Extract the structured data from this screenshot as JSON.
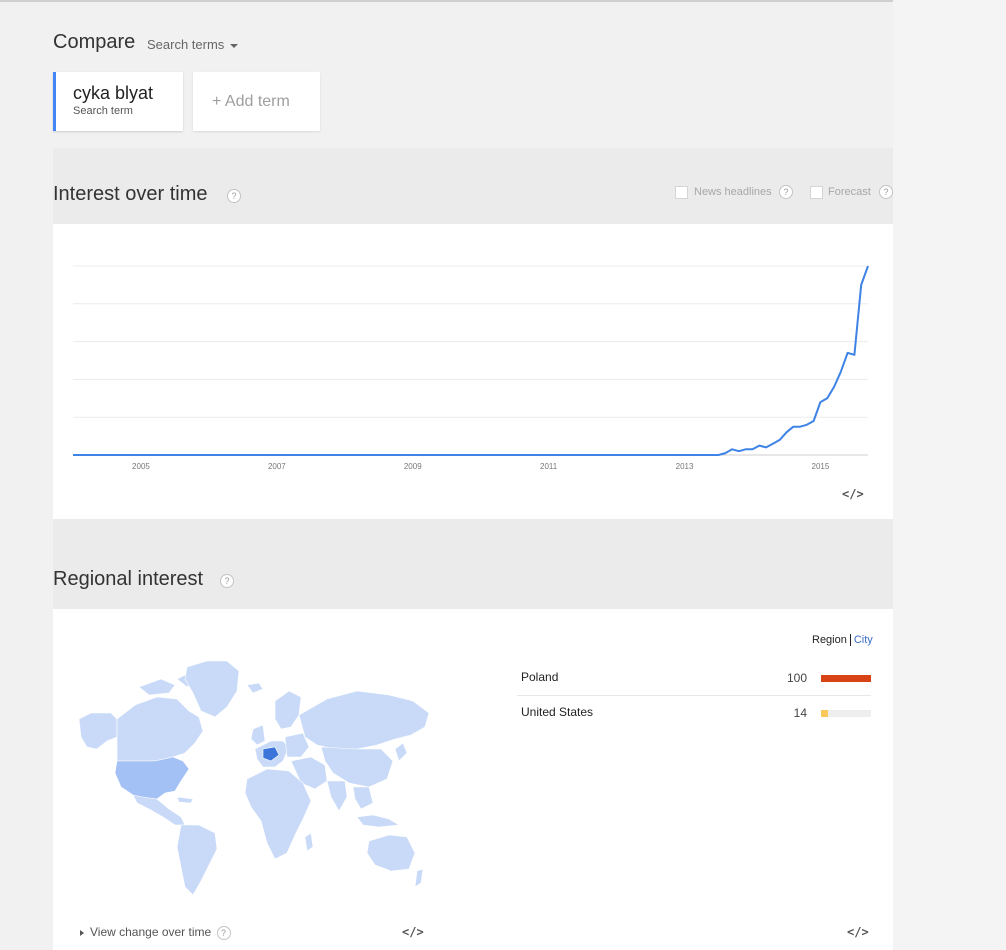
{
  "compare": {
    "title": "Compare",
    "dropdown_label": "Search terms"
  },
  "terms": [
    {
      "term": "cyka blyat",
      "type": "Search term",
      "color": "#4285f4"
    }
  ],
  "add_term": {
    "label": "+ Add term"
  },
  "interest_over_time": {
    "title": "Interest over time",
    "help": "?",
    "options": [
      {
        "label": "News headlines",
        "checked": false
      },
      {
        "label": "Forecast",
        "checked": false
      }
    ],
    "embed": "</>"
  },
  "chart_data": {
    "type": "line",
    "x_labels": [
      "2005",
      "2007",
      "2009",
      "2011",
      "2013",
      "2015"
    ],
    "xlim": [
      2004.0,
      2015.7
    ],
    "ylim": [
      0,
      100
    ],
    "grid": true,
    "line_color": "#3e83e5",
    "series": [
      {
        "x": [
          2004.0,
          2013.5,
          2013.6,
          2013.7,
          2013.8,
          2013.9,
          2014.0,
          2014.1,
          2014.2,
          2014.3,
          2014.4,
          2014.5,
          2014.6,
          2014.7,
          2014.8,
          2014.9,
          2015.0,
          2015.1,
          2015.2,
          2015.3,
          2015.4,
          2015.5,
          2015.6,
          2015.7
        ],
        "y": [
          0,
          0,
          1,
          3,
          2,
          3,
          3,
          5,
          4,
          6,
          8,
          12,
          15,
          15,
          16,
          18,
          28,
          30,
          36,
          44,
          54,
          53,
          90,
          100
        ]
      }
    ]
  },
  "regional_interest": {
    "title": "Regional interest",
    "help": "?",
    "toggle": {
      "region": "Region",
      "city": "City"
    },
    "rows": [
      {
        "name": "Poland",
        "value": "100",
        "level": 1.0,
        "color": "#d84315"
      },
      {
        "name": "United States",
        "value": "14",
        "level": 0.14,
        "color": "#f9c75a"
      }
    ],
    "view_change": "View change over time",
    "help2": "?",
    "embed": "</>",
    "embed2": "</>",
    "map_colors": {
      "land": "#c9daf8",
      "us": "#a3c1f4",
      "poland": "#3b75d9",
      "border": "#ffffff"
    }
  }
}
